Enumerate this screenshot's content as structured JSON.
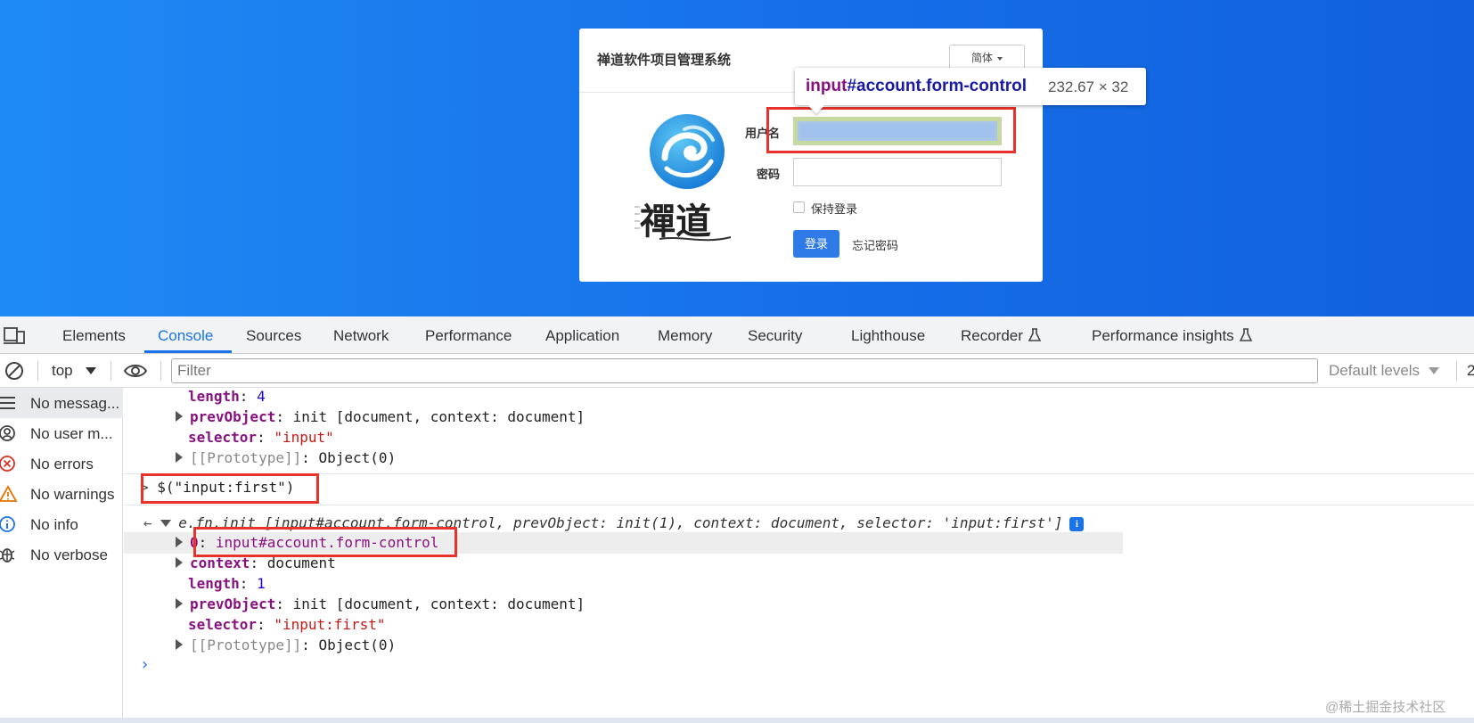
{
  "login": {
    "system_title": "禅道软件项目管理系统",
    "lang_button": "简体",
    "username_label": "用户名",
    "password_label": "密码",
    "keep_login_label": "保持登录",
    "login_button": "登录",
    "forgot_password": "忘记密码",
    "logo_text": "禪道"
  },
  "inspect_tooltip": {
    "tag": "input",
    "selector": "#account.form-control",
    "size": "232.67 × 32"
  },
  "devtools": {
    "tabs": [
      {
        "label": "Elements"
      },
      {
        "label": "Console"
      },
      {
        "label": "Sources"
      },
      {
        "label": "Network"
      },
      {
        "label": "Performance"
      },
      {
        "label": "Application"
      },
      {
        "label": "Memory"
      },
      {
        "label": "Security"
      },
      {
        "label": "Lighthouse"
      },
      {
        "label": "Recorder"
      },
      {
        "label": "Performance insights"
      }
    ],
    "active_tab": "Console",
    "toolbar": {
      "context": "top",
      "filter_placeholder": "Filter",
      "levels": "Default levels",
      "issues_count": "2"
    },
    "sidebar": [
      {
        "label": "No messag..."
      },
      {
        "label": "No user m..."
      },
      {
        "label": "No errors"
      },
      {
        "label": "No warnings"
      },
      {
        "label": "No info"
      },
      {
        "label": "No verbose"
      }
    ]
  },
  "console": {
    "prev_length_key": "length",
    "prev_length_val": "4",
    "prev_prevObject_key": "prevObject",
    "prev_prevObject_val": "init [document, context: document]",
    "prev_selector_key": "selector",
    "prev_selector_val": "\"input\"",
    "prev_proto_key": "[[Prototype]]",
    "prev_proto_val": "Object(0)",
    "command": "$(\"input:first\")",
    "result_summary": "e.fn.init [input#account.form-control, prevObject: init(1), context: document, selector: 'input:first']",
    "item0_key": "0",
    "item0_val": "input#account.form-control",
    "context_key": "context",
    "context_val": "document",
    "length_key": "length",
    "length_val": "1",
    "prevObject_key": "prevObject",
    "prevObject_val": "init [document, context: document]",
    "selector_key": "selector",
    "selector_val": "\"input:first\"",
    "proto_key": "[[Prototype]]",
    "proto_val": "Object(0)"
  },
  "watermark": "@稀土掘金技术社区",
  "colors": {
    "page_bg": "#176fe8",
    "devtools_accent": "#1a73e8",
    "annotation_red": "#e8322b",
    "key_purple": "#881280",
    "string_red": "#c41a16"
  }
}
